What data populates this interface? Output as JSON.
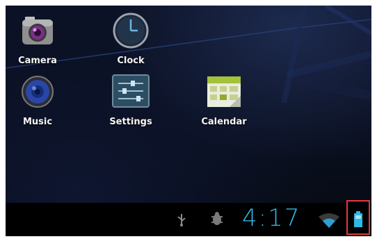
{
  "apps": [
    {
      "label": "Camera",
      "icon": "camera-icon"
    },
    {
      "label": "Clock",
      "icon": "clock-icon"
    },
    {
      "label": "Music",
      "icon": "music-icon"
    },
    {
      "label": "Settings",
      "icon": "settings-icon"
    },
    {
      "label": "Calendar",
      "icon": "calendar-icon"
    }
  ],
  "statusbar": {
    "time": "4:17",
    "icons": [
      "usb-icon",
      "debug-icon",
      "wifi-icon",
      "battery-icon"
    ]
  },
  "colors": {
    "clock_text": "#2fb7e6",
    "highlight": "#e03a3a"
  }
}
